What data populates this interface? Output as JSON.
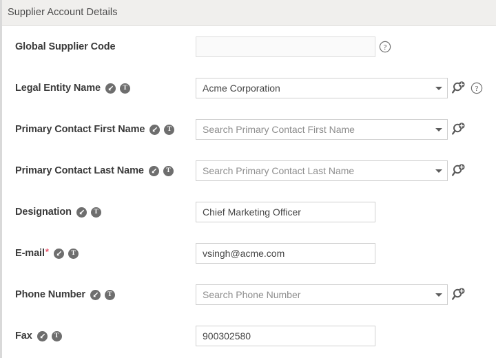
{
  "section": {
    "title": "Supplier Account Details"
  },
  "icons": {
    "badge_import": "import-arrow-icon",
    "badge_text": "text-type-icon",
    "search_plus": "search-add-icon",
    "help": "help-question-icon",
    "caret": "chevron-down-icon",
    "badge_text_glyph": "T"
  },
  "colors": {
    "header_bg": "#f0efed",
    "label_text": "#3a3a3a",
    "required_star": "#e8536b",
    "badge_bg": "#6e6e6e",
    "field_border": "#cfcfcf",
    "disabled_bg": "#fafafa"
  },
  "fields": [
    {
      "label": "Global Supplier Code",
      "required": false,
      "badges": [],
      "control": "disabled",
      "value": "",
      "placeholder": "",
      "trailing": [
        "help"
      ]
    },
    {
      "label": "Legal Entity Name",
      "required": false,
      "badges": [
        "import",
        "text"
      ],
      "control": "combo",
      "value": "Acme Corporation",
      "placeholder": "",
      "trailing": [
        "search-plus",
        "help"
      ]
    },
    {
      "label": "Primary Contact First Name",
      "required": false,
      "badges": [
        "import",
        "text"
      ],
      "control": "combo",
      "value": "",
      "placeholder": "Search Primary Contact First Name",
      "trailing": [
        "search-plus"
      ]
    },
    {
      "label": "Primary Contact Last Name",
      "required": false,
      "badges": [
        "import",
        "text"
      ],
      "control": "combo",
      "value": "",
      "placeholder": "Search Primary Contact Last Name",
      "trailing": [
        "search-plus"
      ]
    },
    {
      "label": "Designation",
      "required": false,
      "badges": [
        "import",
        "text"
      ],
      "control": "text",
      "value": "Chief Marketing Officer",
      "placeholder": "",
      "trailing": []
    },
    {
      "label": "E-mail",
      "required": true,
      "badges": [
        "import",
        "text"
      ],
      "control": "text",
      "value": "vsingh@acme.com",
      "placeholder": "",
      "trailing": []
    },
    {
      "label": "Phone Number",
      "required": false,
      "badges": [
        "import",
        "text"
      ],
      "control": "combo",
      "value": "",
      "placeholder": "Search Phone Number",
      "trailing": [
        "search-plus"
      ]
    },
    {
      "label": "Fax",
      "required": false,
      "badges": [
        "import",
        "text"
      ],
      "control": "text",
      "value": "900302580",
      "placeholder": "",
      "trailing": []
    }
  ]
}
